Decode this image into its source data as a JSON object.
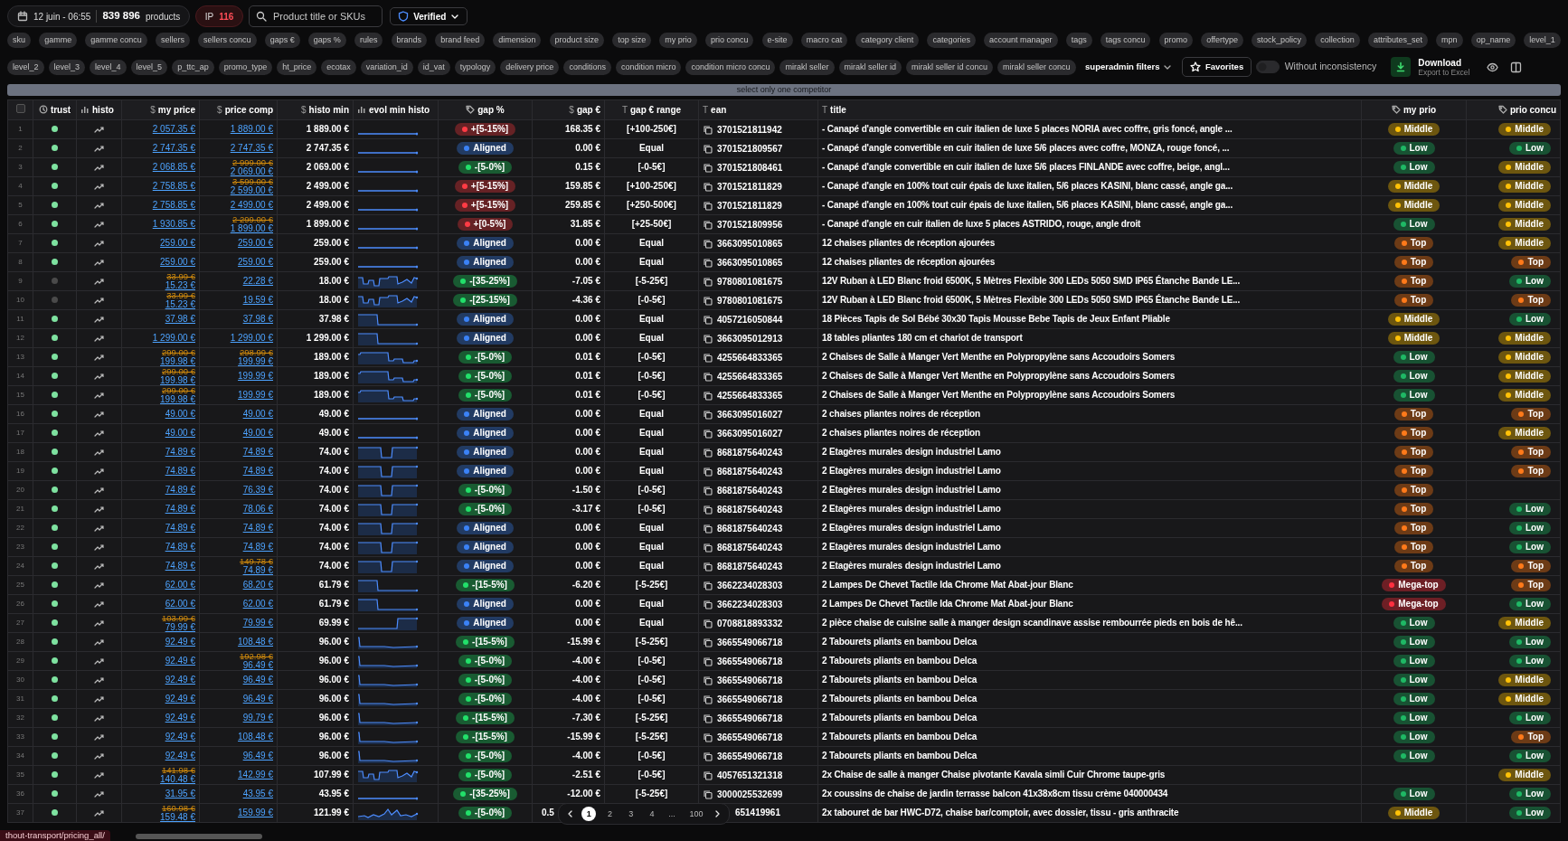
{
  "toolbar": {
    "date": "12 juin - 06:55",
    "product_count": "839 896",
    "products_label": "products",
    "ip": {
      "label": "IP",
      "value": "116"
    },
    "search": {
      "placeholder": "Product title or SKUs"
    },
    "verified": {
      "label": "Verified"
    }
  },
  "chips_row1": [
    "sku",
    "gamme",
    "gamme concu",
    "sellers",
    "sellers concu",
    "gaps €",
    "gaps %",
    "rules",
    "brands",
    "brand feed",
    "dimension",
    "product size",
    "top size",
    "my prio",
    "prio concu",
    "e-site",
    "macro cat",
    "category client",
    "categories",
    "account manager",
    "tags",
    "tags concu",
    "promo",
    "offertype",
    "stock_policy",
    "collection",
    "attributes_set",
    "mpn",
    "op_name",
    "level_1"
  ],
  "chips_row2": [
    "level_2",
    "level_3",
    "level_4",
    "level_5",
    "p_ttc_ap",
    "promo_type",
    "ht_price",
    "ecotax",
    "variation_id",
    "id_vat",
    "typology",
    "delivery price",
    "conditions",
    "condition micro",
    "condition micro concu",
    "mirakl seller",
    "mirakl seller id",
    "mirakl seller id concu",
    "mirakl seller concu"
  ],
  "superadmin": {
    "label": "superadmin filters"
  },
  "favorites": {
    "label": "Favorites"
  },
  "inconsistency": {
    "label": "Without inconsistency",
    "on": false
  },
  "download": {
    "label": "Download",
    "sublabel": "Export to Excel"
  },
  "competitor_bar": "select only one competitor",
  "select_all": {
    "checked": false
  },
  "columns": [
    {
      "label": "trust",
      "kind": "clock"
    },
    {
      "label": "histo",
      "kind": "bars"
    },
    {
      "label": "my price",
      "glyph": "$"
    },
    {
      "label": "price comp",
      "glyph": "$"
    },
    {
      "label": "histo min",
      "glyph": "$"
    },
    {
      "label": "evol min histo",
      "kind": "bars"
    },
    {
      "label": "gap %",
      "kind": "tag"
    },
    {
      "label": "gap €",
      "glyph": "$"
    },
    {
      "label": "gap € range",
      "glyph": "T"
    },
    {
      "label": "ean",
      "glyph": "T"
    },
    {
      "label": "title",
      "glyph": "T"
    },
    {
      "label": "my prio",
      "kind": "tag"
    },
    {
      "label": "prio concu",
      "kind": "tag"
    }
  ],
  "rows": [
    {
      "n": "1",
      "trust": {
        "color": "#7ee2a0"
      },
      "my": {
        "price": "2 057.35 €"
      },
      "comp": {
        "price": "1 889.00 €"
      },
      "min": "1 889.00 €",
      "sparkline": {
        "kind": "flat"
      },
      "gap": {
        "label": "+[5-15%]",
        "color": "#ff3b45"
      },
      "eur": "168.35 €",
      "range": "[+100-250€]",
      "ean": "3701521811942",
      "title": "- Canapé d'angle convertible en cuir italien de luxe 5 places NORIA avec coffre, gris foncé, angle ...",
      "my_prio": {
        "label": "Middle",
        "color": "#ffc107"
      },
      "prio_concu": {
        "label": "Middle",
        "color": "#ffc107"
      }
    },
    {
      "n": "2",
      "trust": {
        "color": "#7ee2a0"
      },
      "my": {
        "price": "2 747.35 €"
      },
      "comp": {
        "price": "2 747.35 €"
      },
      "min": "2 747.35 €",
      "sparkline": {
        "kind": "flat"
      },
      "gap": {
        "label": "Aligned",
        "color": "#3b82f6"
      },
      "eur": "0.00 €",
      "range": "Equal",
      "ean": "3701521809567",
      "title": "- Canapé d'angle convertible en cuir italien de luxe 5/6 places avec coffre, MONZA, rouge foncé, ...",
      "my_prio": {
        "label": "Low",
        "color": "#1fb865"
      },
      "prio_concu": {
        "label": "Low",
        "color": "#1fb865"
      }
    },
    {
      "n": "3",
      "trust": {
        "color": "#7ee2a0"
      },
      "my": {
        "price": "2 068.85 €"
      },
      "comp": {
        "old": "2 999.00 €",
        "price": "2 069.00 €"
      },
      "min": "2 069.00 €",
      "sparkline": {
        "kind": "flat"
      },
      "gap": {
        "label": "-[5-0%]",
        "color": "#22e06a"
      },
      "eur": "0.15 €",
      "range": "[-0-5€]",
      "ean": "3701521808461",
      "title": "- Canapé d'angle convertible en cuir italien de luxe 5/6 places FINLANDE avec coffre, beige, angl...",
      "my_prio": {
        "label": "Low",
        "color": "#1fb865"
      },
      "prio_concu": {
        "label": "Middle",
        "color": "#ffc107"
      }
    },
    {
      "n": "4",
      "trust": {
        "color": "#7ee2a0"
      },
      "my": {
        "price": "2 758.85 €"
      },
      "comp": {
        "old": "3 599.00 €",
        "price": "2 599.00 €"
      },
      "min": "2 499.00 €",
      "sparkline": {
        "kind": "flat"
      },
      "gap": {
        "label": "+[5-15%]",
        "color": "#ff3b45"
      },
      "eur": "159.85 €",
      "range": "[+100-250€]",
      "ean": "3701521811829",
      "title": "- Canapé d'angle en 100% tout cuir épais de luxe italien, 5/6 places KASINI, blanc cassé, angle ga...",
      "my_prio": {
        "label": "Middle",
        "color": "#ffc107"
      },
      "prio_concu": {
        "label": "Middle",
        "color": "#ffc107"
      }
    },
    {
      "n": "5",
      "trust": {
        "color": "#7ee2a0"
      },
      "my": {
        "price": "2 758.85 €"
      },
      "comp": {
        "price": "2 499.00 €"
      },
      "min": "2 499.00 €",
      "sparkline": {
        "kind": "flat"
      },
      "gap": {
        "label": "+[5-15%]",
        "color": "#ff3b45"
      },
      "eur": "259.85 €",
      "range": "[+250-500€]",
      "ean": "3701521811829",
      "title": "- Canapé d'angle en 100% tout cuir épais de luxe italien, 5/6 places KASINI, blanc cassé, angle ga...",
      "my_prio": {
        "label": "Middle",
        "color": "#ffc107"
      },
      "prio_concu": {
        "label": "Middle",
        "color": "#ffc107"
      }
    },
    {
      "n": "6",
      "trust": {
        "color": "#7ee2a0"
      },
      "my": {
        "price": "1 930.85 €"
      },
      "comp": {
        "old": "2 299.00 €",
        "price": "1 899.00 €"
      },
      "min": "1 899.00 €",
      "sparkline": {
        "kind": "flat"
      },
      "gap": {
        "label": "+[0-5%]",
        "color": "#ff3b45"
      },
      "eur": "31.85 €",
      "range": "[+25-50€]",
      "ean": "3701521809956",
      "title": "- Canapé d'angle en cuir italien de luxe 5 places ASTRIDO, rouge, angle droit",
      "my_prio": {
        "label": "Low",
        "color": "#1fb865"
      },
      "prio_concu": {
        "label": "Middle",
        "color": "#ffc107"
      }
    },
    {
      "n": "7",
      "trust": {
        "color": "#7ee2a0"
      },
      "my": {
        "price": "259.00 €"
      },
      "comp": {
        "price": "259.00 €"
      },
      "min": "259.00 €",
      "sparkline": {
        "kind": "flat"
      },
      "gap": {
        "label": "Aligned",
        "color": "#3b82f6"
      },
      "eur": "0.00 €",
      "range": "Equal",
      "ean": "3663095010865",
      "title": "12 chaises pliantes de réception ajourées",
      "my_prio": {
        "label": "Top",
        "color": "#ff7a1a"
      },
      "prio_concu": {
        "label": "Middle",
        "color": "#ffc107"
      }
    },
    {
      "n": "8",
      "trust": {
        "color": "#7ee2a0"
      },
      "my": {
        "price": "259.00 €"
      },
      "comp": {
        "price": "259.00 €"
      },
      "min": "259.00 €",
      "sparkline": {
        "kind": "flat"
      },
      "gap": {
        "label": "Aligned",
        "color": "#3b82f6"
      },
      "eur": "0.00 €",
      "range": "Equal",
      "ean": "3663095010865",
      "title": "12 chaises pliantes de réception ajourées",
      "my_prio": {
        "label": "Top",
        "color": "#ff7a1a"
      },
      "prio_concu": {
        "label": "Top",
        "color": "#ff7a1a"
      }
    },
    {
      "n": "9",
      "trust": {
        "color": "#4a4a4a"
      },
      "my": {
        "old": "33.99 €",
        "price": "15.23 €"
      },
      "comp": {
        "price": "22.28 €"
      },
      "min": "18.00 €",
      "sparkline": {
        "kind": "wave"
      },
      "gap": {
        "label": "-[35-25%]",
        "color": "#22e06a"
      },
      "eur": "-7.05 €",
      "range": "[-5-25€]",
      "ean": "9780801081675",
      "title": "12V Ruban à LED Blanc froid 6500K, 5 Mètres Flexible 300 LEDs 5050 SMD IP65 Étanche Bande LE...",
      "my_prio": {
        "label": "Top",
        "color": "#ff7a1a"
      },
      "prio_concu": {
        "label": "Low",
        "color": "#1fb865"
      }
    },
    {
      "n": "10",
      "trust": {
        "color": "#4a4a4a"
      },
      "my": {
        "old": "33.99 €",
        "price": "15.23 €"
      },
      "comp": {
        "price": "19.59 €"
      },
      "min": "18.00 €",
      "sparkline": {
        "kind": "wave"
      },
      "gap": {
        "label": "-[25-15%]",
        "color": "#22e06a"
      },
      "eur": "-4.36 €",
      "range": "[-0-5€]",
      "ean": "9780801081675",
      "title": "12V Ruban à LED Blanc froid 6500K, 5 Mètres Flexible 300 LEDs 5050 SMD IP65 Étanche Bande LE...",
      "my_prio": {
        "label": "Top",
        "color": "#ff7a1a"
      },
      "prio_concu": {
        "label": "Top",
        "color": "#ff7a1a"
      }
    },
    {
      "n": "11",
      "trust": {
        "color": "#7ee2a0"
      },
      "my": {
        "price": "37.98 €"
      },
      "comp": {
        "price": "37.98 €"
      },
      "min": "37.98 €",
      "sparkline": {
        "kind": "drop"
      },
      "gap": {
        "label": "Aligned",
        "color": "#3b82f6"
      },
      "eur": "0.00 €",
      "range": "Equal",
      "ean": "4057216050844",
      "title": "18 Pièces Tapis de Sol Bébé 30x30 Tapis Mousse Bebe Tapis de Jeux Enfant Pliable",
      "my_prio": {
        "label": "Middle",
        "color": "#ffc107"
      },
      "prio_concu": {
        "label": "Low",
        "color": "#1fb865"
      }
    },
    {
      "n": "12",
      "trust": {
        "color": "#7ee2a0"
      },
      "my": {
        "price": "1 299.00 €"
      },
      "comp": {
        "price": "1 299.00 €"
      },
      "min": "1 299.00 €",
      "sparkline": {
        "kind": "drop"
      },
      "gap": {
        "label": "Aligned",
        "color": "#3b82f6"
      },
      "eur": "0.00 €",
      "range": "Equal",
      "ean": "3663095012913",
      "title": "18 tables pliantes 180 cm et chariot de transport",
      "my_prio": {
        "label": "Middle",
        "color": "#ffc107"
      },
      "prio_concu": {
        "label": "Middle",
        "color": "#ffc107"
      }
    },
    {
      "n": "13",
      "trust": {
        "color": "#7ee2a0"
      },
      "my": {
        "old": "299.00 €",
        "price": "199.98 €"
      },
      "comp": {
        "old": "298.99 €",
        "price": "199.99 €"
      },
      "min": "189.00 €",
      "sparkline": {
        "kind": "steps"
      },
      "gap": {
        "label": "-[5-0%]",
        "color": "#22e06a"
      },
      "eur": "0.01 €",
      "range": "[-0-5€]",
      "ean": "4255664833365",
      "title": "2 Chaises de Salle à Manger Vert Menthe en Polypropylène sans Accoudoirs Somers",
      "my_prio": {
        "label": "Low",
        "color": "#1fb865"
      },
      "prio_concu": {
        "label": "Middle",
        "color": "#ffc107"
      }
    },
    {
      "n": "14",
      "trust": {
        "color": "#7ee2a0"
      },
      "my": {
        "old": "299.00 €",
        "price": "199.98 €"
      },
      "comp": {
        "price": "199.99 €"
      },
      "min": "189.00 €",
      "sparkline": {
        "kind": "steps"
      },
      "gap": {
        "label": "-[5-0%]",
        "color": "#22e06a"
      },
      "eur": "0.01 €",
      "range": "[-0-5€]",
      "ean": "4255664833365",
      "title": "2 Chaises de Salle à Manger Vert Menthe en Polypropylène sans Accoudoirs Somers",
      "my_prio": {
        "label": "Low",
        "color": "#1fb865"
      },
      "prio_concu": {
        "label": "Middle",
        "color": "#ffc107"
      }
    },
    {
      "n": "15",
      "trust": {
        "color": "#7ee2a0"
      },
      "my": {
        "old": "299.00 €",
        "price": "199.98 €"
      },
      "comp": {
        "price": "199.99 €"
      },
      "min": "189.00 €",
      "sparkline": {
        "kind": "steps"
      },
      "gap": {
        "label": "-[5-0%]",
        "color": "#22e06a"
      },
      "eur": "0.01 €",
      "range": "[-0-5€]",
      "ean": "4255664833365",
      "title": "2 Chaises de Salle à Manger Vert Menthe en Polypropylène sans Accoudoirs Somers",
      "my_prio": {
        "label": "Low",
        "color": "#1fb865"
      },
      "prio_concu": {
        "label": "Middle",
        "color": "#ffc107"
      }
    },
    {
      "n": "16",
      "trust": {
        "color": "#7ee2a0"
      },
      "my": {
        "price": "49.00 €"
      },
      "comp": {
        "price": "49.00 €"
      },
      "min": "49.00 €",
      "sparkline": {
        "kind": "flat"
      },
      "gap": {
        "label": "Aligned",
        "color": "#3b82f6"
      },
      "eur": "0.00 €",
      "range": "Equal",
      "ean": "3663095016027",
      "title": "2 chaises pliantes noires de réception",
      "my_prio": {
        "label": "Top",
        "color": "#ff7a1a"
      },
      "prio_concu": {
        "label": "Top",
        "color": "#ff7a1a"
      }
    },
    {
      "n": "17",
      "trust": {
        "color": "#7ee2a0"
      },
      "my": {
        "price": "49.00 €"
      },
      "comp": {
        "price": "49.00 €"
      },
      "min": "49.00 €",
      "sparkline": {
        "kind": "flat"
      },
      "gap": {
        "label": "Aligned",
        "color": "#3b82f6"
      },
      "eur": "0.00 €",
      "range": "Equal",
      "ean": "3663095016027",
      "title": "2 chaises pliantes noires de réception",
      "my_prio": {
        "label": "Top",
        "color": "#ff7a1a"
      },
      "prio_concu": {
        "label": "Middle",
        "color": "#ffc107"
      }
    },
    {
      "n": "18",
      "trust": {
        "color": "#7ee2a0"
      },
      "my": {
        "price": "74.89 €"
      },
      "comp": {
        "price": "74.89 €"
      },
      "min": "74.00 €",
      "sparkline": {
        "kind": "dip"
      },
      "gap": {
        "label": "Aligned",
        "color": "#3b82f6"
      },
      "eur": "0.00 €",
      "range": "Equal",
      "ean": "8681875640243",
      "title": "2 Etagères murales design industriel Lamo",
      "my_prio": {
        "label": "Top",
        "color": "#ff7a1a"
      },
      "prio_concu": {
        "label": "Top",
        "color": "#ff7a1a"
      }
    },
    {
      "n": "19",
      "trust": {
        "color": "#7ee2a0"
      },
      "my": {
        "price": "74.89 €"
      },
      "comp": {
        "price": "74.89 €"
      },
      "min": "74.00 €",
      "sparkline": {
        "kind": "dip"
      },
      "gap": {
        "label": "Aligned",
        "color": "#3b82f6"
      },
      "eur": "0.00 €",
      "range": "Equal",
      "ean": "8681875640243",
      "title": "2 Etagères murales design industriel Lamo",
      "my_prio": {
        "label": "Top",
        "color": "#ff7a1a"
      },
      "prio_concu": {
        "label": "Top",
        "color": "#ff7a1a"
      }
    },
    {
      "n": "20",
      "trust": {
        "color": "#7ee2a0"
      },
      "my": {
        "price": "74.89 €"
      },
      "comp": {
        "price": "76.39 €"
      },
      "min": "74.00 €",
      "sparkline": {
        "kind": "dip"
      },
      "gap": {
        "label": "-[5-0%]",
        "color": "#22e06a"
      },
      "eur": "-1.50 €",
      "range": "[-0-5€]",
      "ean": "8681875640243",
      "title": "2 Etagères murales design industriel Lamo",
      "my_prio": {
        "label": "Top",
        "color": "#ff7a1a"
      }
    },
    {
      "n": "21",
      "trust": {
        "color": "#7ee2a0"
      },
      "my": {
        "price": "74.89 €"
      },
      "comp": {
        "price": "78.06 €"
      },
      "min": "74.00 €",
      "sparkline": {
        "kind": "dip"
      },
      "gap": {
        "label": "-[5-0%]",
        "color": "#22e06a"
      },
      "eur": "-3.17 €",
      "range": "[-0-5€]",
      "ean": "8681875640243",
      "title": "2 Etagères murales design industriel Lamo",
      "my_prio": {
        "label": "Top",
        "color": "#ff7a1a"
      },
      "prio_concu": {
        "label": "Low",
        "color": "#1fb865"
      }
    },
    {
      "n": "22",
      "trust": {
        "color": "#7ee2a0"
      },
      "my": {
        "price": "74.89 €"
      },
      "comp": {
        "price": "74.89 €"
      },
      "min": "74.00 €",
      "sparkline": {
        "kind": "dip"
      },
      "gap": {
        "label": "Aligned",
        "color": "#3b82f6"
      },
      "eur": "0.00 €",
      "range": "Equal",
      "ean": "8681875640243",
      "title": "2 Etagères murales design industriel Lamo",
      "my_prio": {
        "label": "Top",
        "color": "#ff7a1a"
      },
      "prio_concu": {
        "label": "Low",
        "color": "#1fb865"
      }
    },
    {
      "n": "23",
      "trust": {
        "color": "#7ee2a0"
      },
      "my": {
        "price": "74.89 €"
      },
      "comp": {
        "price": "74.89 €"
      },
      "min": "74.00 €",
      "sparkline": {
        "kind": "dip"
      },
      "gap": {
        "label": "Aligned",
        "color": "#3b82f6"
      },
      "eur": "0.00 €",
      "range": "Equal",
      "ean": "8681875640243",
      "title": "2 Etagères murales design industriel Lamo",
      "my_prio": {
        "label": "Top",
        "color": "#ff7a1a"
      },
      "prio_concu": {
        "label": "Low",
        "color": "#1fb865"
      }
    },
    {
      "n": "24",
      "trust": {
        "color": "#7ee2a0"
      },
      "my": {
        "price": "74.89 €"
      },
      "comp": {
        "old": "149.78 €",
        "price": "74.89 €"
      },
      "min": "74.00 €",
      "sparkline": {
        "kind": "dip"
      },
      "gap": {
        "label": "Aligned",
        "color": "#3b82f6"
      },
      "eur": "0.00 €",
      "range": "Equal",
      "ean": "8681875640243",
      "title": "2 Etagères murales design industriel Lamo",
      "my_prio": {
        "label": "Top",
        "color": "#ff7a1a"
      },
      "prio_concu": {
        "label": "Top",
        "color": "#ff7a1a"
      }
    },
    {
      "n": "25",
      "trust": {
        "color": "#7ee2a0"
      },
      "my": {
        "price": "62.00 €"
      },
      "comp": {
        "price": "68.20 €"
      },
      "min": "61.79 €",
      "sparkline": {
        "kind": "drop"
      },
      "gap": {
        "label": "-[15-5%]",
        "color": "#22e06a"
      },
      "eur": "-6.20 €",
      "range": "[-5-25€]",
      "ean": "3662234028303",
      "title": "2 Lampes De Chevet Tactile Ida Chrome Mat Abat-jour Blanc",
      "my_prio": {
        "label": "Mega-top",
        "color": "#ff3040"
      },
      "prio_concu": {
        "label": "Top",
        "color": "#ff7a1a"
      }
    },
    {
      "n": "26",
      "trust": {
        "color": "#7ee2a0"
      },
      "my": {
        "price": "62.00 €"
      },
      "comp": {
        "price": "62.00 €"
      },
      "min": "61.79 €",
      "sparkline": {
        "kind": "drop"
      },
      "gap": {
        "label": "Aligned",
        "color": "#3b82f6"
      },
      "eur": "0.00 €",
      "range": "Equal",
      "ean": "3662234028303",
      "title": "2 Lampes De Chevet Tactile Ida Chrome Mat Abat-jour Blanc",
      "my_prio": {
        "label": "Mega-top",
        "color": "#ff3040"
      },
      "prio_concu": {
        "label": "Low",
        "color": "#1fb865"
      }
    },
    {
      "n": "27",
      "trust": {
        "color": "#7ee2a0"
      },
      "my": {
        "old": "103.99 €",
        "price": "79.99 €"
      },
      "comp": {
        "price": "79.99 €"
      },
      "min": "69.99 €",
      "sparkline": {
        "kind": "rise"
      },
      "gap": {
        "label": "Aligned",
        "color": "#3b82f6"
      },
      "eur": "0.00 €",
      "range": "Equal",
      "ean": "0708818893332",
      "title": "2 pièce chaise de cuisine salle à manger design scandinave assise rembourrée pieds en bois de hê...",
      "my_prio": {
        "label": "Low",
        "color": "#1fb865"
      },
      "prio_concu": {
        "label": "Middle",
        "color": "#ffc107"
      }
    },
    {
      "n": "28",
      "trust": {
        "color": "#7ee2a0"
      },
      "my": {
        "price": "92.49 €"
      },
      "comp": {
        "price": "108.48 €"
      },
      "min": "96.00 €",
      "sparkline": {
        "kind": "spike"
      },
      "gap": {
        "label": "-[15-5%]",
        "color": "#22e06a"
      },
      "eur": "-15.99 €",
      "range": "[-5-25€]",
      "ean": "3665549066718",
      "title": "2 Tabourets pliants en bambou Delca",
      "my_prio": {
        "label": "Low",
        "color": "#1fb865"
      },
      "prio_concu": {
        "label": "Low",
        "color": "#1fb865"
      }
    },
    {
      "n": "29",
      "trust": {
        "color": "#7ee2a0"
      },
      "my": {
        "price": "92.49 €"
      },
      "comp": {
        "old": "192.98 €",
        "price": "96.49 €"
      },
      "min": "96.00 €",
      "sparkline": {
        "kind": "spike"
      },
      "gap": {
        "label": "-[5-0%]",
        "color": "#22e06a"
      },
      "eur": "-4.00 €",
      "range": "[-0-5€]",
      "ean": "3665549066718",
      "title": "2 Tabourets pliants en bambou Delca",
      "my_prio": {
        "label": "Low",
        "color": "#1fb865"
      },
      "prio_concu": {
        "label": "Low",
        "color": "#1fb865"
      }
    },
    {
      "n": "30",
      "trust": {
        "color": "#7ee2a0"
      },
      "my": {
        "price": "92.49 €"
      },
      "comp": {
        "price": "96.49 €"
      },
      "min": "96.00 €",
      "sparkline": {
        "kind": "spike"
      },
      "gap": {
        "label": "-[5-0%]",
        "color": "#22e06a"
      },
      "eur": "-4.00 €",
      "range": "[-0-5€]",
      "ean": "3665549066718",
      "title": "2 Tabourets pliants en bambou Delca",
      "my_prio": {
        "label": "Low",
        "color": "#1fb865"
      },
      "prio_concu": {
        "label": "Middle",
        "color": "#ffc107"
      }
    },
    {
      "n": "31",
      "trust": {
        "color": "#7ee2a0"
      },
      "my": {
        "price": "92.49 €"
      },
      "comp": {
        "price": "96.49 €"
      },
      "min": "96.00 €",
      "sparkline": {
        "kind": "spike"
      },
      "gap": {
        "label": "-[5-0%]",
        "color": "#22e06a"
      },
      "eur": "-4.00 €",
      "range": "[-0-5€]",
      "ean": "3665549066718",
      "title": "2 Tabourets pliants en bambou Delca",
      "my_prio": {
        "label": "Low",
        "color": "#1fb865"
      },
      "prio_concu": {
        "label": "Middle",
        "color": "#ffc107"
      }
    },
    {
      "n": "32",
      "trust": {
        "color": "#7ee2a0"
      },
      "my": {
        "price": "92.49 €"
      },
      "comp": {
        "price": "99.79 €"
      },
      "min": "96.00 €",
      "sparkline": {
        "kind": "spike"
      },
      "gap": {
        "label": "-[15-5%]",
        "color": "#22e06a"
      },
      "eur": "-7.30 €",
      "range": "[-5-25€]",
      "ean": "3665549066718",
      "title": "2 Tabourets pliants en bambou Delca",
      "my_prio": {
        "label": "Low",
        "color": "#1fb865"
      },
      "prio_concu": {
        "label": "Low",
        "color": "#1fb865"
      }
    },
    {
      "n": "33",
      "trust": {
        "color": "#7ee2a0"
      },
      "my": {
        "price": "92.49 €"
      },
      "comp": {
        "price": "108.48 €"
      },
      "min": "96.00 €",
      "sparkline": {
        "kind": "spike"
      },
      "gap": {
        "label": "-[15-5%]",
        "color": "#22e06a"
      },
      "eur": "-15.99 €",
      "range": "[-5-25€]",
      "ean": "3665549066718",
      "title": "2 Tabourets pliants en bambou Delca",
      "my_prio": {
        "label": "Low",
        "color": "#1fb865"
      },
      "prio_concu": {
        "label": "Top",
        "color": "#ff7a1a"
      }
    },
    {
      "n": "34",
      "trust": {
        "color": "#7ee2a0"
      },
      "my": {
        "price": "92.49 €"
      },
      "comp": {
        "price": "96.49 €"
      },
      "min": "96.00 €",
      "sparkline": {
        "kind": "spike"
      },
      "gap": {
        "label": "-[5-0%]",
        "color": "#22e06a"
      },
      "eur": "-4.00 €",
      "range": "[-0-5€]",
      "ean": "3665549066718",
      "title": "2 Tabourets pliants en bambou Delca",
      "my_prio": {
        "label": "Low",
        "color": "#1fb865"
      },
      "prio_concu": {
        "label": "Low",
        "color": "#1fb865"
      }
    },
    {
      "n": "35",
      "trust": {
        "color": "#7ee2a0"
      },
      "my": {
        "old": "141.98 €",
        "price": "140.48 €"
      },
      "comp": {
        "price": "142.99 €"
      },
      "min": "107.99 €",
      "sparkline": {
        "kind": "wave"
      },
      "gap": {
        "label": "-[5-0%]",
        "color": "#22e06a"
      },
      "eur": "-2.51 €",
      "range": "[-0-5€]",
      "ean": "4057651321318",
      "title": "2x Chaise de salle à manger Chaise pivotante Kavala simli Cuir Chrome taupe-gris",
      "prio_concu": {
        "label": "Middle",
        "color": "#ffc107"
      }
    },
    {
      "n": "36",
      "trust": {
        "color": "#7ee2a0"
      },
      "my": {
        "price": "31.95 €"
      },
      "comp": {
        "price": "43.95 €"
      },
      "min": "43.95 €",
      "sparkline": {
        "kind": "flat"
      },
      "gap": {
        "label": "-[35-25%]",
        "color": "#22e06a"
      },
      "eur": "-12.00 €",
      "range": "[-5-25€]",
      "ean": "3000025532699",
      "title": "2x coussins de chaise de jardin terrasse balcon 41x38x8cm tissu crème 040000434",
      "my_prio": {
        "label": "Low",
        "color": "#1fb865"
      },
      "prio_concu": {
        "label": "Low",
        "color": "#1fb865"
      }
    },
    {
      "n": "37",
      "trust": {
        "color": "#7ee2a0"
      },
      "my": {
        "old": "160.98 €",
        "price": "159.48 €"
      },
      "comp": {
        "price": "159.99 €"
      },
      "min": "121.99 €",
      "sparkline": {
        "kind": "wave2"
      },
      "gap": {
        "label": "-[5-0%]",
        "color": "#22e06a"
      },
      "eur": "0.5",
      "ean": "651419961",
      "ean_cut": true,
      "title": "2x tabouret de bar HWC-D72, chaise bar/comptoir, avec dossier, tissu - gris anthracite",
      "my_prio": {
        "label": "Middle",
        "color": "#ffc107"
      },
      "prio_concu": {
        "label": "Low",
        "color": "#1fb865"
      }
    }
  ],
  "pagination": {
    "pages": [
      {
        "label": "1",
        "selected": true
      },
      {
        "label": "2",
        "selected": false
      },
      {
        "label": "3",
        "selected": false
      },
      {
        "label": "4",
        "selected": false
      }
    ],
    "ellipsis": "...",
    "last_page": {
      "label": "100",
      "selected": false
    }
  },
  "status_url": "thout-transport/pricing_all/"
}
